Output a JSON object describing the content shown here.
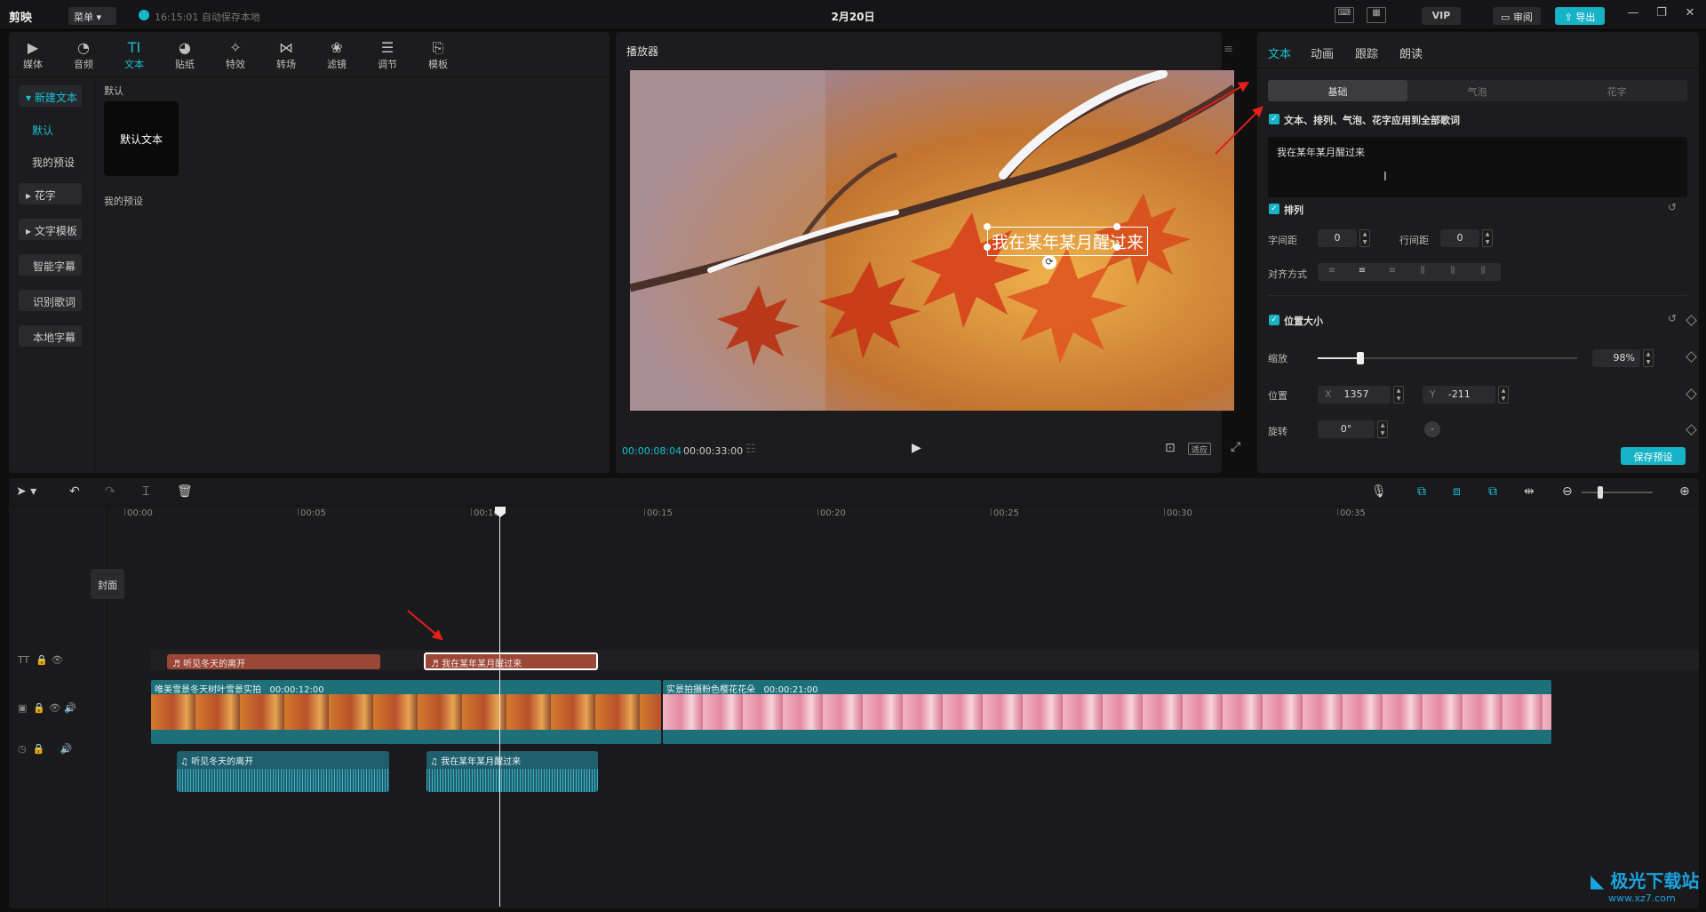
{
  "app": {
    "name": "剪映",
    "menu": "菜单",
    "autosave": "16:15:01 自动保存本地",
    "title": "2月20日",
    "vip": "VIP",
    "review": "审阅",
    "export": "导出"
  },
  "media_tabs": [
    {
      "label": "媒体",
      "icon": "media-icon"
    },
    {
      "label": "音频",
      "icon": "audio-icon"
    },
    {
      "label": "文本",
      "icon": "text-icon"
    },
    {
      "label": "贴纸",
      "icon": "sticker-icon"
    },
    {
      "label": "特效",
      "icon": "effects-icon"
    },
    {
      "label": "转场",
      "icon": "transition-icon"
    },
    {
      "label": "滤镜",
      "icon": "filter-icon"
    },
    {
      "label": "调节",
      "icon": "adjust-icon"
    },
    {
      "label": "模板",
      "icon": "template-icon"
    }
  ],
  "left_sidebar": {
    "new_text": "新建文本",
    "default": "默认",
    "my_presets": "我的预设",
    "huazi": "花字",
    "text_template": "文字模板",
    "smart_subtitle": "智能字幕",
    "recognize_lyrics": "识别歌词",
    "local_subtitle": "本地字幕"
  },
  "left_content": {
    "section_default": "默认",
    "default_card": "默认文本",
    "section_my_presets": "我的预设"
  },
  "player": {
    "title": "播放器",
    "current_time": "00:00:08:04",
    "total_time": "00:00:33:00",
    "overlay_text": "我在某年某月醒过来",
    "fit_label": "适应"
  },
  "right_panel": {
    "tabs": [
      "文本",
      "动画",
      "跟踪",
      "朗读"
    ],
    "subtabs": [
      "基础",
      "气泡",
      "花字"
    ],
    "apply_all": "文本、排列、气泡、花字应用到全部歌词",
    "text_value": "我在某年某月醒过来",
    "arrange": {
      "label": "排列",
      "letter_spacing_label": "字间距",
      "letter_spacing": "0",
      "line_spacing_label": "行间距",
      "line_spacing": "0",
      "align_label": "对齐方式"
    },
    "position": {
      "label": "位置大小",
      "scale_label": "缩放",
      "scale_value": "98%",
      "scale_fraction": 0.98,
      "pos_label": "位置",
      "x_label": "X",
      "x": "1357",
      "y_label": "Y",
      "y": "-211",
      "rotate_label": "旋转",
      "rotate": "0°"
    },
    "save_preset": "保存预设"
  },
  "timeline": {
    "ruler": [
      "00:00",
      "00:05",
      "00:10",
      "00:15",
      "00:20",
      "00:25",
      "00:30",
      "00:35"
    ],
    "cover": "封面",
    "text_clips": [
      "听见冬天的离开",
      "我在某年某月醒过来"
    ],
    "video_clips": [
      {
        "name": "唯美雪景冬天树叶雪景实拍",
        "duration": "00:00:12:00"
      },
      {
        "name": "实景拍摄粉色樱花花朵",
        "duration": "00:00:21:00"
      }
    ],
    "audio_clips": [
      "听见冬天的离开",
      "我在某年某月醒过来"
    ]
  },
  "watermark": {
    "brand": "极光下载站",
    "url": "www.xz7.com"
  },
  "colors": {
    "accent": "#19c0d3",
    "text_clip": "#9a4737",
    "video_clip": "#1d6f79",
    "annotation_arrow": "#e0201a"
  }
}
